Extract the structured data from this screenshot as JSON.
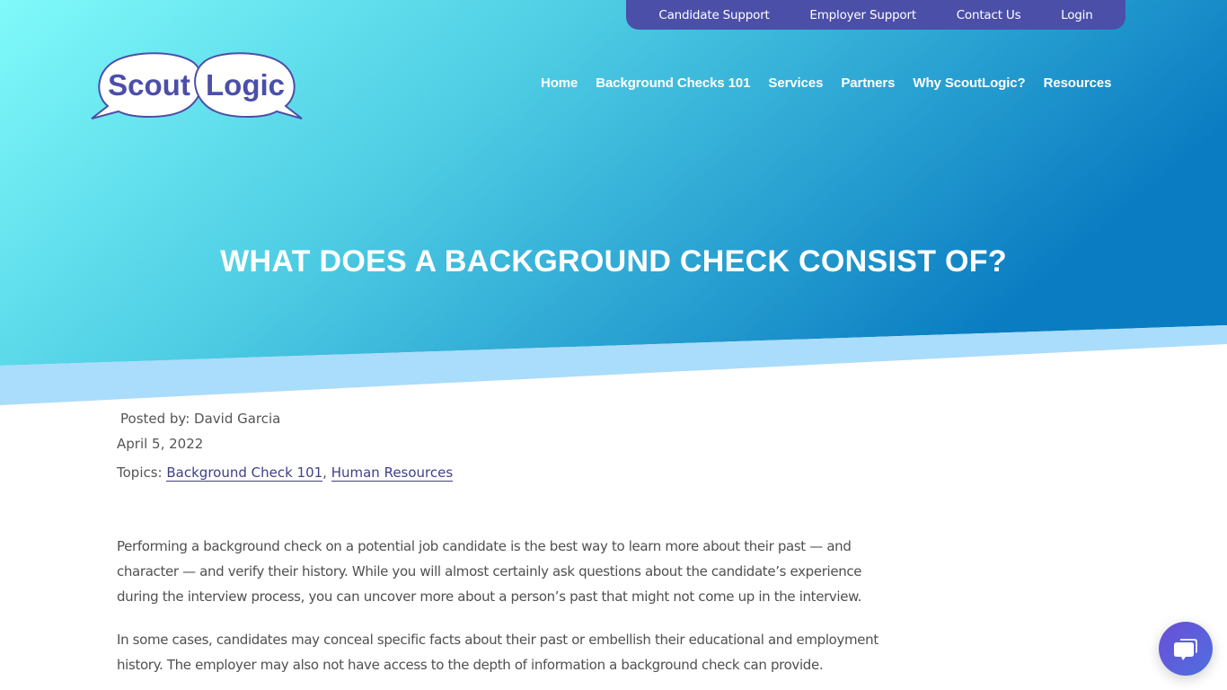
{
  "brand": {
    "logo_word1": "Scout",
    "logo_word2": "Logic",
    "colors": {
      "hero_gradient_start": "#7ef7f7",
      "hero_gradient_end": "#0a7cc2",
      "band": "#aadcfc",
      "topbar": "#4b4fa8",
      "logo_text": "#4b4fa8",
      "link": "#3e3f8a"
    }
  },
  "topbar": {
    "items": [
      {
        "label": "Candidate Support"
      },
      {
        "label": "Employer Support"
      },
      {
        "label": "Contact Us"
      },
      {
        "label": "Login"
      }
    ]
  },
  "nav": {
    "items": [
      {
        "label": "Home"
      },
      {
        "label": "Background Checks 101"
      },
      {
        "label": "Services"
      },
      {
        "label": "Partners"
      },
      {
        "label": "Why ScoutLogic?"
      },
      {
        "label": "Resources"
      }
    ]
  },
  "page": {
    "title": "WHAT DOES A BACKGROUND CHECK CONSIST OF?"
  },
  "meta": {
    "posted_by": "Posted by: David Garcia",
    "date": "April 5, 2022",
    "topics_label": "Topics: ",
    "topics": [
      {
        "label": "Background Check 101"
      },
      {
        "label": "Human Resources"
      }
    ],
    "separator": ", "
  },
  "article": {
    "paragraphs": [
      "Performing a background check on a potential job candidate is the best way to learn more about their past — and character — and verify their history. While you will almost certainly ask questions about the candidate’s experience during the interview process, you can uncover more about a person’s past that might not come up in the interview.",
      "In some cases, candidates may conceal specific facts about their past or embellish their educational and employment history. The employer may also not have access to the depth of information a background check can provide."
    ]
  },
  "chat": {
    "icon": "chat-bubbles-icon"
  }
}
